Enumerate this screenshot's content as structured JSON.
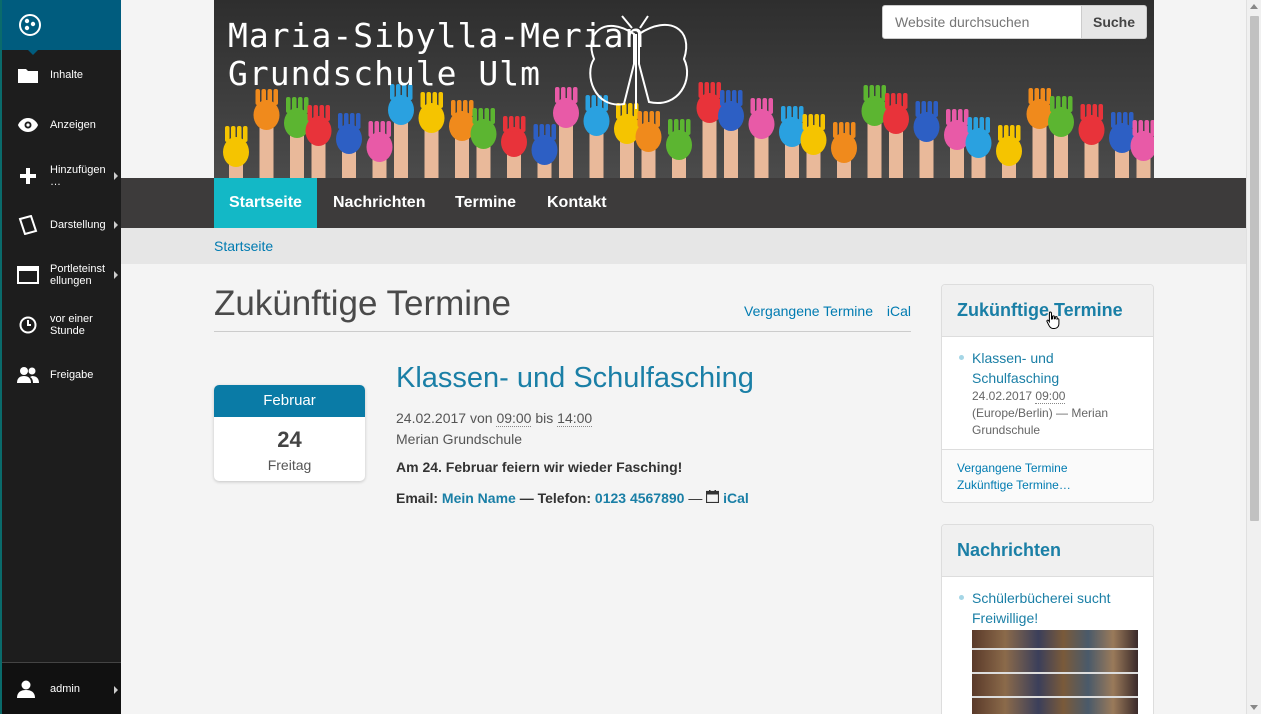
{
  "toolbar": {
    "items": [
      {
        "label": "Inhalte",
        "icon": "folder-icon"
      },
      {
        "label": "Anzeigen",
        "icon": "eye-icon"
      },
      {
        "label": "Hinzufügen …",
        "icon": "plus-icon"
      },
      {
        "label": "Darstellung",
        "icon": "display-icon"
      },
      {
        "label": "Portleteinst ellungen",
        "icon": "portlet-icon"
      },
      {
        "label": "vor einer Stunde",
        "icon": "clock-icon"
      },
      {
        "label": "Freigabe",
        "icon": "users-icon"
      }
    ],
    "user": "admin"
  },
  "banner": {
    "line1": "Maria-Sibylla-Merian",
    "line2": "Grundschule Ulm"
  },
  "search": {
    "placeholder": "Website durchsuchen",
    "button": "Suche"
  },
  "nav": {
    "items": [
      "Startseite",
      "Nachrichten",
      "Termine",
      "Kontakt"
    ],
    "active": "Startseite"
  },
  "breadcrumb": "Startseite",
  "main": {
    "title": "Zukünftige Termine",
    "link_past": "Vergangene Termine",
    "link_ical": "iCal",
    "event": {
      "month": "Februar",
      "day": "24",
      "weekday": "Freitag",
      "title": "Klassen- und Schulfasching",
      "date": "24.02.2017",
      "von": "von",
      "start": "09:00",
      "bis": "bis",
      "end": "14:00",
      "location": "Merian Grundschule",
      "description": "Am 24. Februar feiern wir wieder Fasching!",
      "email_label": "Email:",
      "email_name": "Mein Name",
      "phone_label": "— Telefon:",
      "phone": "0123 4567890",
      "dash": "—",
      "ical": "iCal"
    }
  },
  "portlet_events": {
    "title": "Zukünftige Termine",
    "item_title": "Klassen- und Schulfasching",
    "item_date": "24.02.2017",
    "item_time": "09:00",
    "item_meta": "(Europe/Berlin) — Merian Grundschule",
    "link_past": "Vergangene Termine",
    "link_future": "Zukünftige Termine…"
  },
  "portlet_news": {
    "title": "Nachrichten",
    "item_title": "Schülerbücherei sucht Freiwillige!"
  },
  "colors": {
    "accent": "#13b8c6",
    "link": "#1a7fa6",
    "toolbar": "#1d1d1d",
    "nav": "#3d3b3b"
  }
}
